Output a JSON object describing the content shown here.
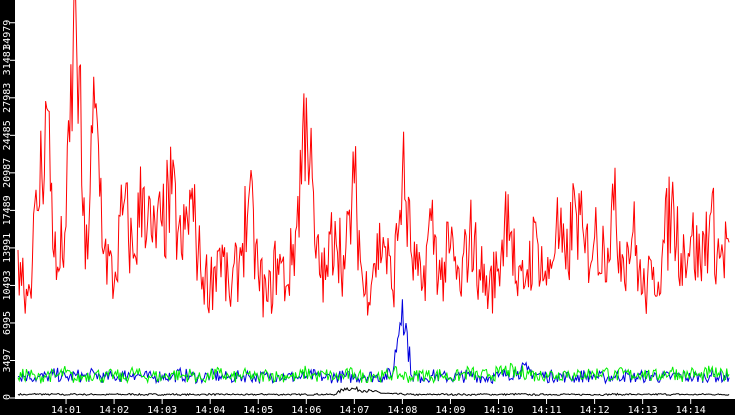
{
  "chart_data": {
    "type": "line",
    "title": "",
    "xlabel": "",
    "ylabel": "",
    "x_start_minutes": 0,
    "x_step_minutes": 0.2,
    "xlim_minutes": [
      0,
      14.95
    ],
    "ylim": [
      0,
      37100
    ],
    "y_ticks": [
      0,
      3497,
      6995,
      10493,
      13991,
      17489,
      20987,
      24485,
      27983,
      31481,
      34979
    ],
    "x_ticks": [
      {
        "minute": 1,
        "label": "14:01"
      },
      {
        "minute": 2,
        "label": "14:02"
      },
      {
        "minute": 3,
        "label": "14:03"
      },
      {
        "minute": 4,
        "label": "14:04"
      },
      {
        "minute": 5,
        "label": "14:05"
      },
      {
        "minute": 6,
        "label": "14:06"
      },
      {
        "minute": 7,
        "label": "14:07"
      },
      {
        "minute": 8,
        "label": "14:08"
      },
      {
        "minute": 9,
        "label": "14:09"
      },
      {
        "minute": 10,
        "label": "14:10"
      },
      {
        "minute": 11,
        "label": "14:11"
      },
      {
        "minute": 12,
        "label": "14:12"
      },
      {
        "minute": 13,
        "label": "14:13"
      },
      {
        "minute": 14,
        "label": "14:14"
      }
    ],
    "grid": false,
    "series": [
      {
        "name": "red",
        "color": "#ff0000",
        "values": [
          13800,
          9500,
          17500,
          27000,
          11000,
          16000,
          37000,
          12000,
          27000,
          14000,
          10500,
          18000,
          13000,
          19500,
          14500,
          16000,
          19000,
          13500,
          18500,
          12000,
          10500,
          14000,
          9500,
          12500,
          18500,
          11500,
          9000,
          13000,
          10500,
          16000,
          28000,
          13000,
          11000,
          16500,
          12000,
          20000,
          9500,
          12500,
          15000,
          10000,
          21000,
          13000,
          10000,
          16500,
          11000,
          14000,
          10000,
          15500,
          12000,
          10000,
          12000,
          19000,
          9500,
          12000,
          15000,
          10500,
          16000,
          12000,
          18000,
          13500,
          15000,
          14000,
          17500,
          13000,
          15500,
          9800,
          11000,
          13000,
          18000,
          13500,
          15000,
          12500,
          17000,
          13000,
          14500
        ]
      },
      {
        "name": "green",
        "color": "#00ee00",
        "values": [
          1900,
          2300,
          1800,
          2200,
          2000,
          2400,
          1700,
          2100,
          2300,
          1900,
          2200,
          1800,
          2400,
          2000,
          2100,
          1900,
          2300,
          2000,
          2200,
          1800,
          2100,
          2300,
          1900,
          2000,
          2200,
          1800,
          2300,
          2000,
          2100,
          1900,
          2400,
          2000,
          2200,
          1900,
          2100,
          2300,
          1900,
          2200,
          2000,
          2300,
          2100,
          1900,
          2300,
          2000,
          2200,
          1900,
          2100,
          2400,
          2000,
          2200,
          2300,
          2600,
          2200,
          2500,
          2000,
          2300,
          2100,
          2400,
          2000,
          2300,
          2200,
          2500,
          2000,
          2300,
          2100,
          2400,
          2000,
          2200,
          2500,
          2100,
          2300,
          2000,
          2400,
          2100,
          2200
        ]
      },
      {
        "name": "blue",
        "color": "#0000dd",
        "values": [
          2000,
          2100,
          1900,
          2000,
          2200,
          1900,
          2100,
          2000,
          2200,
          1900,
          2000,
          2100,
          2300,
          2000,
          1900,
          2100,
          2000,
          2200,
          2000,
          1900,
          2100,
          2000,
          1900,
          2000,
          2100,
          1900,
          2000,
          2100,
          2000,
          1900,
          2000,
          2100,
          1900,
          2000,
          2000,
          1900,
          2100,
          2000,
          2000,
          2300,
          9200,
          2000,
          1900,
          2100,
          2000,
          1900,
          2000,
          2100,
          2000,
          1900,
          2000,
          2300,
          2500,
          2600,
          2200,
          2000,
          2100,
          2000,
          1900,
          2100,
          2000,
          1900,
          2000,
          2100,
          1900,
          2000,
          2100,
          1900,
          2000,
          2100,
          1900,
          2000,
          2100,
          2000,
          1900
        ]
      },
      {
        "name": "black",
        "color": "#000000",
        "values": [
          350,
          300,
          380,
          320,
          350,
          300,
          360,
          320,
          340,
          300,
          350,
          320,
          360,
          300,
          340,
          320,
          350,
          300,
          330,
          320,
          350,
          310,
          340,
          320,
          300,
          330,
          350,
          320,
          340,
          310,
          330,
          350,
          320,
          340,
          900,
          850,
          700,
          600,
          450,
          380,
          350,
          320,
          300,
          330,
          350,
          320,
          340,
          300,
          330,
          350,
          320,
          340,
          360,
          330,
          300,
          340,
          320,
          350,
          300,
          330,
          340,
          310,
          350,
          320,
          340,
          300,
          330,
          350,
          320,
          340,
          310,
          330,
          350,
          320,
          340
        ]
      }
    ]
  }
}
